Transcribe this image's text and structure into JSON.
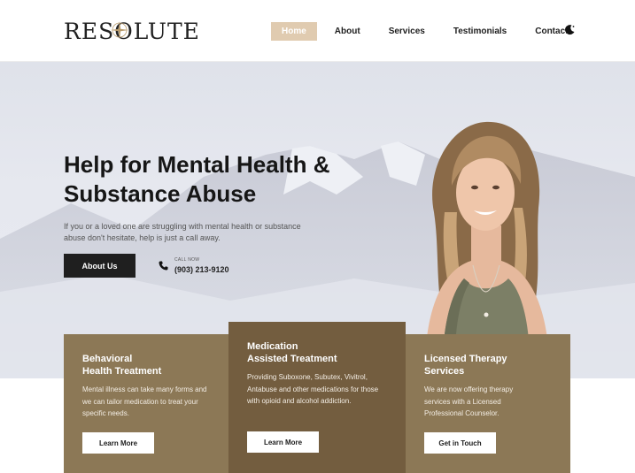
{
  "header": {
    "logo_text": "RESOLUTE",
    "nav": [
      {
        "label": "Home",
        "active": true
      },
      {
        "label": "About",
        "active": false
      },
      {
        "label": "Services",
        "active": false
      },
      {
        "label": "Testimonials",
        "active": false
      },
      {
        "label": "Contact",
        "active": false
      }
    ],
    "theme_icon": "moon-icon"
  },
  "hero": {
    "title": "Help for Mental Health & Substance Abuse",
    "subtitle": "If you or a loved one are struggling with mental health or substance abuse don't hesitate, help is just a call away.",
    "cta_label": "About Us",
    "call_label": "CALL NOW",
    "phone": "(903) 213-9120"
  },
  "cards": [
    {
      "title": "Behavioral\nHealth Treatment",
      "text": "Mental illness can take many forms and we can tailor medication to treat your specific needs.",
      "button": "Learn More"
    },
    {
      "title": "Medication\nAssisted Treatment",
      "text": "Providing Suboxone, Subutex, Vivitrol, Antabuse and other medications for those with opioid and alcohol addiction.",
      "button": "Learn More"
    },
    {
      "title": "Licensed Therapy\nServices",
      "text": "We are now offering therapy services with a Licensed Professional Counselor.",
      "button": "Get in Touch"
    }
  ],
  "colors": {
    "accent": "#e0cbb0",
    "card": "#8c7856",
    "card_featured": "#735d3f",
    "dark": "#1f1f1f"
  }
}
